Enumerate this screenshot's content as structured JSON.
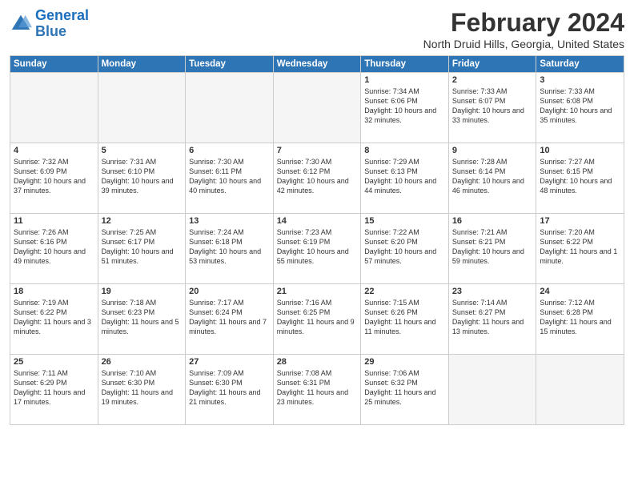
{
  "header": {
    "logo_line1": "General",
    "logo_line2": "Blue",
    "title": "February 2024",
    "subtitle": "North Druid Hills, Georgia, United States"
  },
  "days_of_week": [
    "Sunday",
    "Monday",
    "Tuesday",
    "Wednesday",
    "Thursday",
    "Friday",
    "Saturday"
  ],
  "weeks": [
    [
      {
        "day": "",
        "info": "",
        "empty": true
      },
      {
        "day": "",
        "info": "",
        "empty": true
      },
      {
        "day": "",
        "info": "",
        "empty": true
      },
      {
        "day": "",
        "info": "",
        "empty": true
      },
      {
        "day": "1",
        "info": "Sunrise: 7:34 AM\nSunset: 6:06 PM\nDaylight: 10 hours\nand 32 minutes."
      },
      {
        "day": "2",
        "info": "Sunrise: 7:33 AM\nSunset: 6:07 PM\nDaylight: 10 hours\nand 33 minutes."
      },
      {
        "day": "3",
        "info": "Sunrise: 7:33 AM\nSunset: 6:08 PM\nDaylight: 10 hours\nand 35 minutes."
      }
    ],
    [
      {
        "day": "4",
        "info": "Sunrise: 7:32 AM\nSunset: 6:09 PM\nDaylight: 10 hours\nand 37 minutes."
      },
      {
        "day": "5",
        "info": "Sunrise: 7:31 AM\nSunset: 6:10 PM\nDaylight: 10 hours\nand 39 minutes."
      },
      {
        "day": "6",
        "info": "Sunrise: 7:30 AM\nSunset: 6:11 PM\nDaylight: 10 hours\nand 40 minutes."
      },
      {
        "day": "7",
        "info": "Sunrise: 7:30 AM\nSunset: 6:12 PM\nDaylight: 10 hours\nand 42 minutes."
      },
      {
        "day": "8",
        "info": "Sunrise: 7:29 AM\nSunset: 6:13 PM\nDaylight: 10 hours\nand 44 minutes."
      },
      {
        "day": "9",
        "info": "Sunrise: 7:28 AM\nSunset: 6:14 PM\nDaylight: 10 hours\nand 46 minutes."
      },
      {
        "day": "10",
        "info": "Sunrise: 7:27 AM\nSunset: 6:15 PM\nDaylight: 10 hours\nand 48 minutes."
      }
    ],
    [
      {
        "day": "11",
        "info": "Sunrise: 7:26 AM\nSunset: 6:16 PM\nDaylight: 10 hours\nand 49 minutes."
      },
      {
        "day": "12",
        "info": "Sunrise: 7:25 AM\nSunset: 6:17 PM\nDaylight: 10 hours\nand 51 minutes."
      },
      {
        "day": "13",
        "info": "Sunrise: 7:24 AM\nSunset: 6:18 PM\nDaylight: 10 hours\nand 53 minutes."
      },
      {
        "day": "14",
        "info": "Sunrise: 7:23 AM\nSunset: 6:19 PM\nDaylight: 10 hours\nand 55 minutes."
      },
      {
        "day": "15",
        "info": "Sunrise: 7:22 AM\nSunset: 6:20 PM\nDaylight: 10 hours\nand 57 minutes."
      },
      {
        "day": "16",
        "info": "Sunrise: 7:21 AM\nSunset: 6:21 PM\nDaylight: 10 hours\nand 59 minutes."
      },
      {
        "day": "17",
        "info": "Sunrise: 7:20 AM\nSunset: 6:22 PM\nDaylight: 11 hours\nand 1 minute."
      }
    ],
    [
      {
        "day": "18",
        "info": "Sunrise: 7:19 AM\nSunset: 6:22 PM\nDaylight: 11 hours\nand 3 minutes."
      },
      {
        "day": "19",
        "info": "Sunrise: 7:18 AM\nSunset: 6:23 PM\nDaylight: 11 hours\nand 5 minutes."
      },
      {
        "day": "20",
        "info": "Sunrise: 7:17 AM\nSunset: 6:24 PM\nDaylight: 11 hours\nand 7 minutes."
      },
      {
        "day": "21",
        "info": "Sunrise: 7:16 AM\nSunset: 6:25 PM\nDaylight: 11 hours\nand 9 minutes."
      },
      {
        "day": "22",
        "info": "Sunrise: 7:15 AM\nSunset: 6:26 PM\nDaylight: 11 hours\nand 11 minutes."
      },
      {
        "day": "23",
        "info": "Sunrise: 7:14 AM\nSunset: 6:27 PM\nDaylight: 11 hours\nand 13 minutes."
      },
      {
        "day": "24",
        "info": "Sunrise: 7:12 AM\nSunset: 6:28 PM\nDaylight: 11 hours\nand 15 minutes."
      }
    ],
    [
      {
        "day": "25",
        "info": "Sunrise: 7:11 AM\nSunset: 6:29 PM\nDaylight: 11 hours\nand 17 minutes."
      },
      {
        "day": "26",
        "info": "Sunrise: 7:10 AM\nSunset: 6:30 PM\nDaylight: 11 hours\nand 19 minutes."
      },
      {
        "day": "27",
        "info": "Sunrise: 7:09 AM\nSunset: 6:30 PM\nDaylight: 11 hours\nand 21 minutes."
      },
      {
        "day": "28",
        "info": "Sunrise: 7:08 AM\nSunset: 6:31 PM\nDaylight: 11 hours\nand 23 minutes."
      },
      {
        "day": "29",
        "info": "Sunrise: 7:06 AM\nSunset: 6:32 PM\nDaylight: 11 hours\nand 25 minutes."
      },
      {
        "day": "",
        "info": "",
        "empty": true
      },
      {
        "day": "",
        "info": "",
        "empty": true
      }
    ]
  ]
}
